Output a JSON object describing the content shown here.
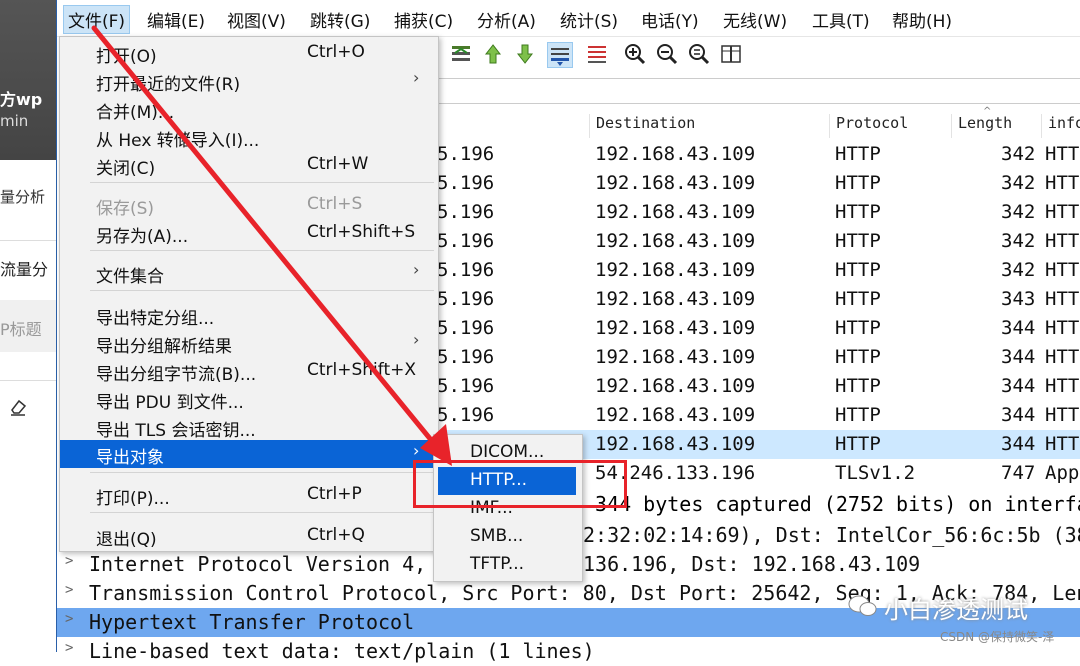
{
  "background_app": {
    "texts": [
      "方wp",
      "min",
      "量分析",
      "流量分",
      "P标题"
    ],
    "eraser_icon": "eraser-icon"
  },
  "menubar": {
    "items": [
      "文件(F)",
      "编辑(E)",
      "视图(V)",
      "跳转(G)",
      "捕获(C)",
      "分析(A)",
      "统计(S)",
      "电话(Y)",
      "无线(W)",
      "工具(T)",
      "帮助(H)"
    ]
  },
  "packet_list": {
    "headers": [
      "Destination",
      "Protocol",
      "Length",
      "info"
    ],
    "rows": [
      {
        "src": "5.196",
        "dst": "192.168.43.109",
        "proto": "HTTP",
        "len": "342",
        "info": "HTT"
      },
      {
        "src": "5.196",
        "dst": "192.168.43.109",
        "proto": "HTTP",
        "len": "342",
        "info": "HTT"
      },
      {
        "src": "5.196",
        "dst": "192.168.43.109",
        "proto": "HTTP",
        "len": "342",
        "info": "HTT"
      },
      {
        "src": "5.196",
        "dst": "192.168.43.109",
        "proto": "HTTP",
        "len": "342",
        "info": "HTT"
      },
      {
        "src": "5.196",
        "dst": "192.168.43.109",
        "proto": "HTTP",
        "len": "342",
        "info": "HTT"
      },
      {
        "src": "5.196",
        "dst": "192.168.43.109",
        "proto": "HTTP",
        "len": "343",
        "info": "HTT"
      },
      {
        "src": "5.196",
        "dst": "192.168.43.109",
        "proto": "HTTP",
        "len": "344",
        "info": "HTT"
      },
      {
        "src": "5.196",
        "dst": "192.168.43.109",
        "proto": "HTTP",
        "len": "344",
        "info": "HTT"
      },
      {
        "src": "5.196",
        "dst": "192.168.43.109",
        "proto": "HTTP",
        "len": "344",
        "info": "HTT"
      },
      {
        "src": "5.196",
        "dst": "192.168.43.109",
        "proto": "HTTP",
        "len": "344",
        "info": "HTT"
      },
      {
        "src": "",
        "dst": "192.168.43.109",
        "proto": "HTTP",
        "len": "344",
        "info": "HTT"
      },
      {
        "src": "",
        "dst": "54.246.133.196",
        "proto": "TLSv1.2",
        "len": "747",
        "info": "App"
      }
    ]
  },
  "details": {
    "frame_tail": "344 bytes captured (2752 bits) on interfa",
    "eth_tail": "2:32:02:14:69), Dst: IntelCor_56:6c:5b (38",
    "ip": "Internet Protocol Version 4,",
    "ip_tail": "136.196, Dst: 192.168.43.109",
    "tcp": "Transmission Control Protocol, Src Port: 80, Dst Port: 25642, Seq: 1, Ack: 784, Len",
    "http": "Hypertext Transfer Protocol",
    "line": "Line-based text data: text/plain (1 lines)"
  },
  "file_menu": {
    "items": [
      {
        "label": "打开(O)",
        "shortcut": "Ctrl+O"
      },
      {
        "label": "打开最近的文件(R)",
        "submenu": true
      },
      {
        "label": "合并(M)..."
      },
      {
        "label": "从 Hex 转储导入(I)..."
      },
      {
        "label": "关闭(C)",
        "shortcut": "Ctrl+W"
      },
      {
        "label": "保存(S)",
        "shortcut": "Ctrl+S",
        "disabled": true
      },
      {
        "label": "另存为(A)...",
        "shortcut": "Ctrl+Shift+S"
      },
      {
        "label": "文件集合",
        "submenu": true
      },
      {
        "label": "导出特定分组..."
      },
      {
        "label": "导出分组解析结果",
        "submenu": true
      },
      {
        "label": "导出分组字节流(B)...",
        "shortcut": "Ctrl+Shift+X"
      },
      {
        "label": "导出 PDU 到文件..."
      },
      {
        "label": "导出 TLS 会话密钥..."
      },
      {
        "label": "导出对象",
        "submenu": true,
        "highlighted": true
      },
      {
        "label": "打印(P)...",
        "shortcut": "Ctrl+P"
      },
      {
        "label": "退出(Q)",
        "shortcut": "Ctrl+Q"
      }
    ]
  },
  "export_objects_submenu": {
    "items": [
      "DICOM...",
      "HTTP...",
      "IMF...",
      "SMB...",
      "TFTP..."
    ],
    "highlighted": "HTTP..."
  },
  "watermark": {
    "main": "小白渗透测试",
    "sub": "CSDN @保持微笑-泽"
  },
  "colors": {
    "menu_highlight": "#0a64d6",
    "selected_row": "#cde8ff",
    "detail_selected": "#6ea7ef",
    "annotation_red": "#e8232a"
  }
}
